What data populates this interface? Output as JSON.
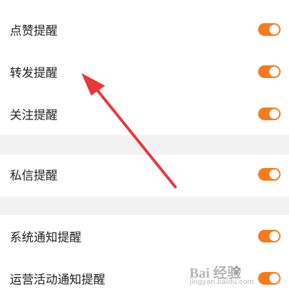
{
  "settings": {
    "items": [
      {
        "label": "点赞提醒",
        "enabled": true
      },
      {
        "label": "转发提醒",
        "enabled": true
      },
      {
        "label": "关注提醒",
        "enabled": true
      },
      {
        "label": "私信提醒",
        "enabled": true
      },
      {
        "label": "系统通知提醒",
        "enabled": true
      },
      {
        "label": "运营活动通知提醒",
        "enabled": true
      }
    ]
  },
  "watermark": {
    "logo_text": "Bai 经验",
    "url": "jingyan.baidu.com"
  },
  "colors": {
    "toggle_on": "#f97a1c",
    "arrow": "#e8383a",
    "section_gap": "#f2f2f2"
  }
}
